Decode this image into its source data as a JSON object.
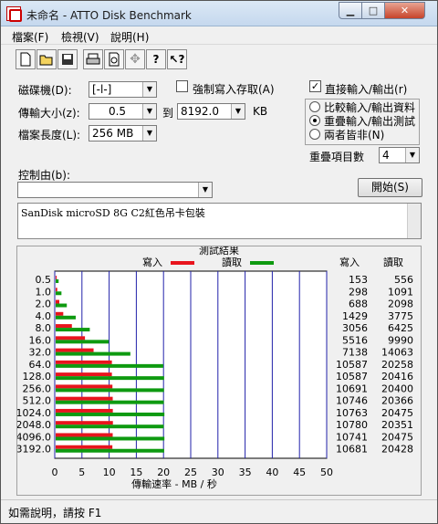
{
  "window": {
    "title": "未命名 - ATTO Disk Benchmark"
  },
  "menu": [
    "檔案(F)",
    "檢視(V)",
    "說明(H)"
  ],
  "toolbar_icons": [
    "new-icon",
    "open-icon",
    "save-icon",
    "print-icon",
    "print-preview-icon",
    "move-icon",
    "help-icon",
    "context-help-icon"
  ],
  "settings": {
    "drive_label": "磁碟機(D):",
    "drive_value": "[-l-]",
    "transfer_size_label": "傳輸大小(z):",
    "transfer_from": "0.5",
    "to_label": "到",
    "transfer_to": "8192.0",
    "unit": "KB",
    "file_length_label": "檔案長度(L):",
    "file_length_value": "256 MB",
    "force_write_label": "強制寫入存取(A)",
    "force_write_checked": false,
    "direct_io_label": "直接輸入/輸出(r)",
    "direct_io_checked": true,
    "radio_compare": "比較輸入/輸出資料",
    "radio_overlap": "重疊輸入/輸出測試",
    "radio_neither": "兩者皆非(N)",
    "selected_radio": "overlap",
    "queue_depth_label": "重疊項目數",
    "queue_depth_value": "4",
    "control_label": "控制由(b):",
    "control_value": "",
    "start_button": "開始(S)",
    "description": "SanDisk microSD 8G C2紅色吊卡包裝"
  },
  "chart_data": {
    "type": "bar",
    "title": "測試結果",
    "orientation": "horizontal",
    "categories": [
      "0.5",
      "1.0",
      "2.0",
      "4.0",
      "8.0",
      "16.0",
      "32.0",
      "64.0",
      "128.0",
      "256.0",
      "512.0",
      "1024.0",
      "2048.0",
      "4096.0",
      "3192.0"
    ],
    "series": [
      {
        "name": "寫入",
        "color": "#e8141d",
        "values": [
          153,
          298,
          688,
          1429,
          3056,
          5516,
          7138,
          10587,
          10587,
          10691,
          10746,
          10763,
          10780,
          10741,
          10681
        ]
      },
      {
        "name": "讀取",
        "color": "#0e9a10",
        "values": [
          556,
          1091,
          2098,
          3775,
          6425,
          9990,
          14063,
          20258,
          20416,
          20400,
          20366,
          20475,
          20351,
          20475,
          20428
        ]
      }
    ],
    "column_headers": [
      "寫入",
      "讀取"
    ],
    "xlabel": "傳輸速率 - MB / 秒",
    "xlim": [
      0,
      50
    ],
    "xticks": [
      "0",
      "5",
      "10",
      "15",
      "20",
      "25",
      "30",
      "35",
      "40",
      "45",
      "50"
    ],
    "grid": true
  },
  "status": {
    "text": "如需說明，請按 F1"
  }
}
